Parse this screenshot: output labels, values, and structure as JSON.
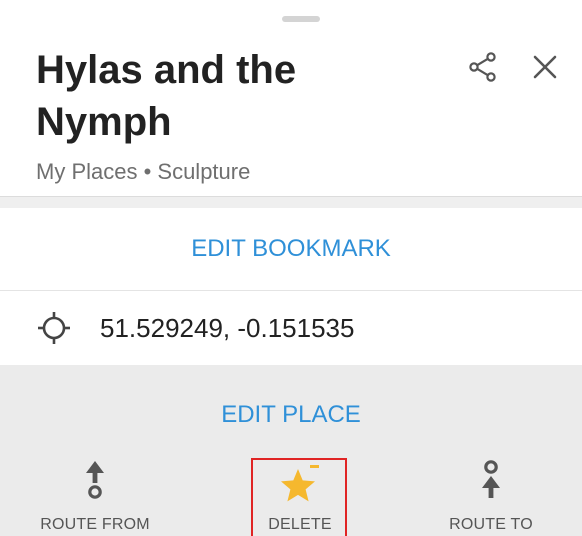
{
  "header": {
    "title": "Hylas and the Nymph",
    "subtitle": "My Places • Sculpture",
    "share_icon": "share-icon",
    "close_icon": "close-icon"
  },
  "bookmark": {
    "edit_label": "EDIT BOOKMARK"
  },
  "location": {
    "icon": "crosshair-icon",
    "coordinates": "51.529249, -0.151535"
  },
  "place": {
    "edit_label": "EDIT PLACE"
  },
  "actions": [
    {
      "label": "ROUTE FROM",
      "icon": "route-from-icon"
    },
    {
      "label": "DELETE",
      "icon": "star-remove-icon",
      "highlighted": true
    },
    {
      "label": "ROUTE TO",
      "icon": "route-to-icon"
    }
  ],
  "colors": {
    "accent": "#2f90d8",
    "star": "#f5b82e",
    "highlight": "#e02424",
    "panel": "#ebebeb"
  }
}
